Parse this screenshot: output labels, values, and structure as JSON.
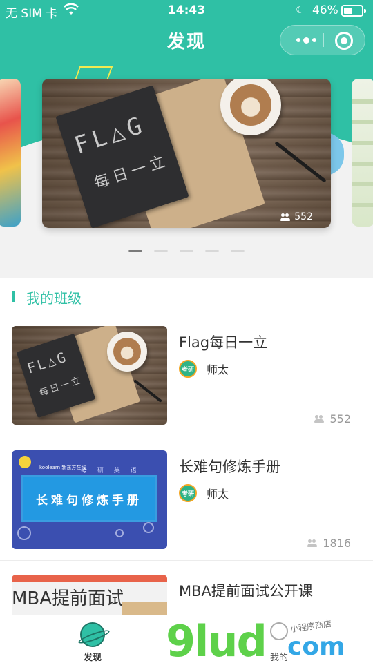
{
  "status_bar": {
    "carrier": "无 SIM 卡",
    "time": "14:43",
    "battery": "46%",
    "battery_level": 0.46
  },
  "header": {
    "title": "发现"
  },
  "banner": {
    "main_card": {
      "cover_text": "FL△G",
      "cover_subtext": "每日一立",
      "count": "552"
    },
    "slide_count": 5,
    "active_slide": 0
  },
  "section": {
    "title": "我的班级"
  },
  "courses": [
    {
      "title": "Flag每日一立",
      "teacher": "师太",
      "avatar_text": "考研",
      "count": "552",
      "cover_text": "FL△G",
      "cover_subtext": "每日一立"
    },
    {
      "title": "长难句修炼手册",
      "teacher": "师太",
      "avatar_text": "考研",
      "count": "1816",
      "cover_text": "长难句修炼手册",
      "cover_subtitle": "考 研 英 语",
      "cover_brand": "koolearn 新东方在线"
    },
    {
      "title": "MBA提前面试公开课",
      "teacher": "",
      "avatar_text": "",
      "count": "",
      "cover_text": "MBA提前面试"
    }
  ],
  "tabbar": {
    "tabs": [
      {
        "label": "发现",
        "active": true
      },
      {
        "label": "我的",
        "active": false
      }
    ]
  },
  "watermark": {
    "text_left": "9lud",
    "text_right": "com",
    "text_small": "小程序商店"
  },
  "colors": {
    "accent": "#2fc0a5",
    "text": "#333333",
    "muted": "#999999"
  }
}
